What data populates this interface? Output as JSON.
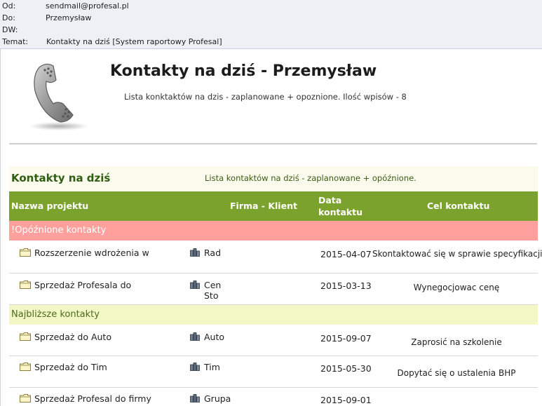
{
  "mail": {
    "from_label": "Od:",
    "from_value": "sendmail@profesal.pl",
    "to_label": "Do:",
    "to_value": "Przemysław",
    "cc_label": "DW:",
    "cc_value": "",
    "subject_label": "Temat:",
    "subject_value": "Kontakty na dziś [System raportowy Profesal]"
  },
  "report": {
    "title": "Kontakty na dziś - Przemysław",
    "subtitle": "Lista konktaktów na dzis - zaplanowane + opoznione. Ilość wpisów - 8",
    "logo_icon": "telephone-handset-icon"
  },
  "section": {
    "title": "Kontakty na dziś",
    "description": "Lista kontaktów na dziś - zaplanowane + opóźnione."
  },
  "table": {
    "headers": {
      "project": "Nazwa projektu",
      "company": "Firma - Klient",
      "date": "Data kontaktu",
      "goal": "Cel kontaktu"
    },
    "groups": [
      {
        "label": "!Opóźnione kontakty",
        "color": "#ffa09d",
        "rows": [
          {
            "project": "Rozszerzenie wdrożenia w",
            "company": "Rad",
            "date": "2015-04-07",
            "goal": "Skontaktować się w sprawie specyfikacji"
          },
          {
            "project": "Sprzedaż Profesala do",
            "company": "Cen\nSto",
            "date": "2015-03-13",
            "goal": "Wynegocjowac cenę"
          }
        ]
      },
      {
        "label": "Najbliższe kontakty",
        "color": "#f1f8c6",
        "rows": [
          {
            "project": "Sprzedaż do Auto",
            "company": "Auto",
            "date": "2015-09-07",
            "goal": "Zaprosić na szkolenie"
          },
          {
            "project": "Sprzedaż do Tim",
            "company": "Tim",
            "date": "2015-05-30",
            "goal": "Dopytać się o ustalenia BHP"
          },
          {
            "project": "Sprzedaż Profesal do firmy",
            "company": "Grupa",
            "date": "2015-09-01",
            "goal": ""
          }
        ]
      }
    ]
  },
  "colors": {
    "header_green": "#7ca22e",
    "section_title": "#2f5d12",
    "late_row": "#ffa09d",
    "near_row": "#f1f8c6"
  }
}
